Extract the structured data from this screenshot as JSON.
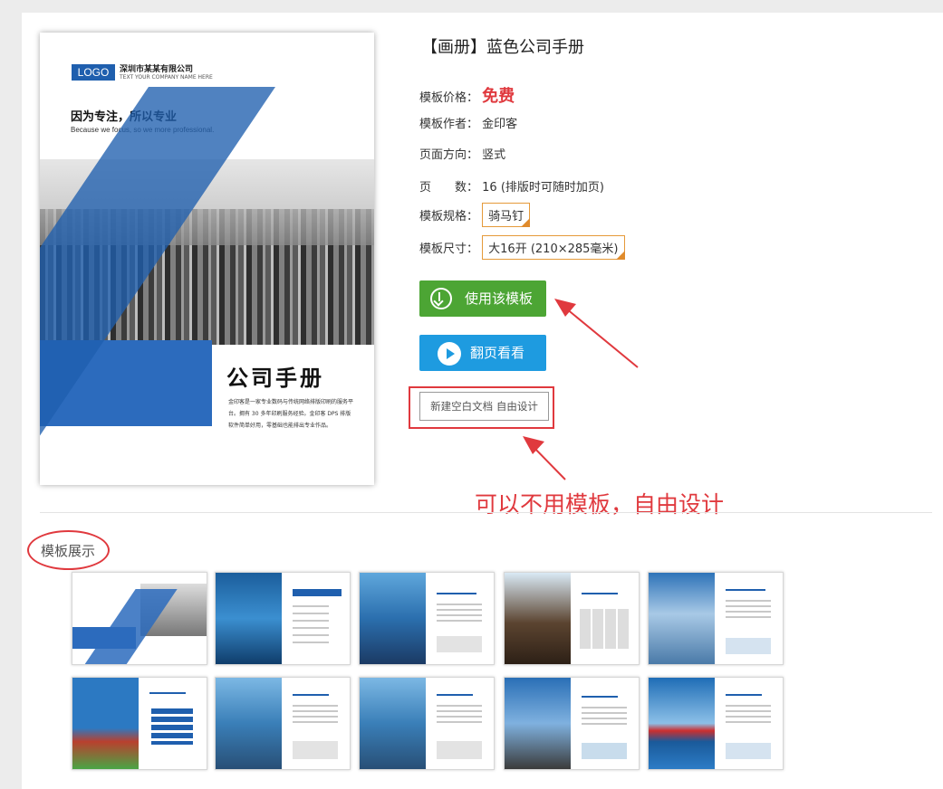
{
  "product": {
    "title": "【画册】蓝色公司手册",
    "price_label": "模板价格：",
    "price_value": "免费",
    "author_label": "模板作者：",
    "author_value": "金印客",
    "orientation_label": "页面方向：",
    "orientation_value": "竖式",
    "pages_label": "页　　数：",
    "pages_value": "16 (排版时可随时加页)",
    "spec_label": "模板规格：",
    "spec_value": "骑马钉",
    "size_label": "模板尺寸：",
    "size_value": "大16开 (210×285毫米)"
  },
  "buttons": {
    "use_template": "使用该模板",
    "flip_view": "翻页看看",
    "new_blank": "新建空白文档 自由设计"
  },
  "annotation": "可以不用模板，自由设计",
  "section": {
    "title": "模板展示"
  },
  "cover": {
    "logo": "LOGO",
    "company": "深圳市某某有限公司",
    "company_en": "TEXT YOUR COMPANY NAME HERE",
    "slogan": "因为专注，所以专业",
    "slogan_en": "Because we focus, so we more professional.",
    "title": "公司手册",
    "desc": "金印客是一家专业数码与传统网络排版印刷的服务平台。拥有 30 多年印刷服务经验。金印客 DPS 排版软件简单好用，零基础也能排出专业作品。"
  },
  "colors": {
    "accent_green": "#4ca534",
    "accent_blue": "#1e9be0",
    "highlight_red": "#e0393e",
    "brand_blue": "#1f5fae"
  }
}
